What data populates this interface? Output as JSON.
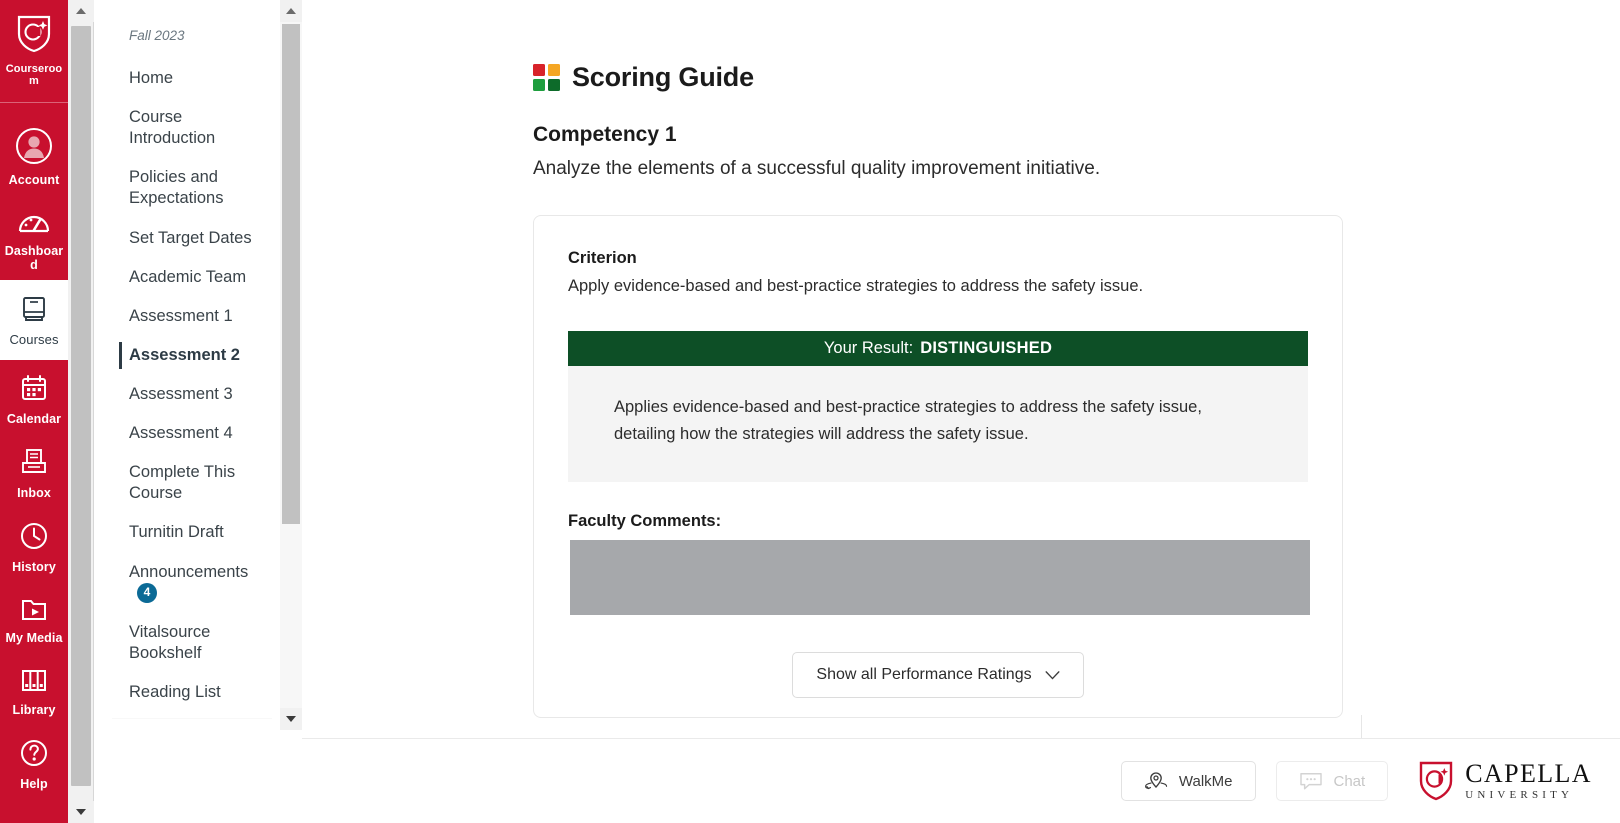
{
  "global_nav": {
    "brand": {
      "label": "Courseroom",
      "icon": "capella-shield-icon"
    },
    "items": [
      {
        "label": "Account",
        "icon": "account-avatar-icon",
        "active": false
      },
      {
        "label": "Dashboard",
        "icon": "dashboard-gauge-icon",
        "active": false
      },
      {
        "label": "Courses",
        "icon": "courses-book-icon",
        "active": true
      },
      {
        "label": "Calendar",
        "icon": "calendar-icon",
        "active": false
      },
      {
        "label": "Inbox",
        "icon": "inbox-tray-icon",
        "active": false
      },
      {
        "label": "History",
        "icon": "history-clock-icon",
        "active": false
      },
      {
        "label": "My Media",
        "icon": "my-media-folder-play-icon",
        "active": false
      },
      {
        "label": "Library",
        "icon": "library-books-icon",
        "active": false
      },
      {
        "label": "Help",
        "icon": "help-question-icon",
        "active": false
      }
    ]
  },
  "course_nav": {
    "term": "Fall 2023",
    "items": [
      {
        "label": "Home",
        "active": false
      },
      {
        "label": "Course Introduction",
        "active": false
      },
      {
        "label": "Policies and Expectations",
        "active": false
      },
      {
        "label": "Set Target Dates",
        "active": false
      },
      {
        "label": "Academic Team",
        "active": false
      },
      {
        "label": "Assessment 1",
        "active": false
      },
      {
        "label": "Assessment 2",
        "active": true
      },
      {
        "label": "Assessment 3",
        "active": false
      },
      {
        "label": "Assessment 4",
        "active": false
      },
      {
        "label": "Complete This Course",
        "active": false
      },
      {
        "label": "Turnitin Draft",
        "active": false
      },
      {
        "label": "Announcements",
        "active": false,
        "badge": "4"
      },
      {
        "label": "Vitalsource Bookshelf",
        "active": false
      },
      {
        "label": "Reading List",
        "active": false
      }
    ]
  },
  "main": {
    "scoring_guide_title": "Scoring Guide",
    "scoring_guide_icon_colors": {
      "top_left": "#d8232a",
      "top_right": "#f5a623",
      "bottom_left": "#1e9e3e",
      "bottom_right": "#0d6b2a"
    },
    "competency_title": "Competency 1",
    "competency_description": "Analyze the elements of a successful quality improvement initiative.",
    "criterion_label": "Criterion",
    "criterion_text": "Apply evidence-based and best-practice strategies to address the safety issue.",
    "result_label": "Your Result:",
    "result_value": "DISTINGUISHED",
    "result_color": "#0d4f26",
    "result_description": "Applies evidence-based and best-practice strategies to address the safety issue, detailing how the strategies will address the safety issue.",
    "faculty_comments_label": "Faculty Comments:",
    "faculty_comments_redacted": true,
    "show_all_button": "Show all Performance Ratings"
  },
  "footer": {
    "walkme_label": "WalkMe",
    "chat_label": "Chat",
    "capella_name": "CAPELLA",
    "capella_sub": "UNIVERSITY",
    "capella_red": "#c8102e"
  }
}
